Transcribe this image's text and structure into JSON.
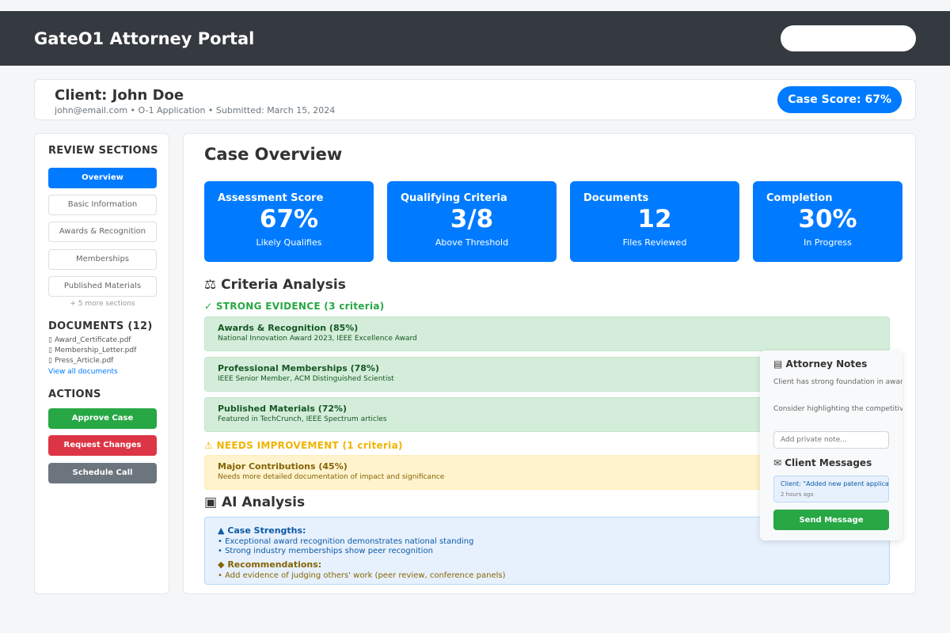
{
  "app": {
    "title": "GateO1 Attorney Portal",
    "search_placeholder": ""
  },
  "client": {
    "name": "Client: John Doe",
    "meta": "john@email.com • O-1 Application • Submitted: March 15, 2024",
    "case_score": "Case Score: 67%"
  },
  "sidebar": {
    "review_heading": "REVIEW SECTIONS",
    "sections": [
      {
        "label": "Overview",
        "active": true
      },
      {
        "label": "Basic Information",
        "active": false
      },
      {
        "label": "Awards & Recognition",
        "active": false
      },
      {
        "label": "Memberships",
        "active": false
      },
      {
        "label": "Published Materials",
        "active": false
      }
    ],
    "more_sections": "+ 5 more sections",
    "documents_heading": "DOCUMENTS (12)",
    "documents": [
      {
        "icon": "document-icon",
        "name": "Award_Certificate.pdf"
      },
      {
        "icon": "document-icon",
        "name": "Membership_Letter.pdf"
      },
      {
        "icon": "document-icon",
        "name": "Press_Article.pdf"
      }
    ],
    "view_all": "View all documents",
    "actions_heading": "ACTIONS",
    "actions": [
      {
        "label": "Approve Case",
        "color": "#28a745"
      },
      {
        "label": "Request Changes",
        "color": "#dc3545"
      },
      {
        "label": "Schedule Call",
        "color": "#6c757d"
      }
    ]
  },
  "main": {
    "title": "Case Overview",
    "stats": [
      {
        "label": "Assessment Score",
        "value": "67%",
        "sub": "Likely Qualifies"
      },
      {
        "label": "Qualifying Criteria",
        "value": "3/8",
        "sub": "Above Threshold"
      },
      {
        "label": "Documents",
        "value": "12",
        "sub": "Files Reviewed"
      },
      {
        "label": "Completion",
        "value": "30%",
        "sub": "In Progress"
      }
    ],
    "criteria_title": "Criteria Analysis",
    "strong_title": "✓ STRONG EVIDENCE (3 criteria)",
    "strong": [
      {
        "name": "Awards & Recognition (85%)",
        "desc": "National Innovation Award 2023, IEEE Excellence Award"
      },
      {
        "name": "Professional Memberships (78%)",
        "desc": "IEEE Senior Member, ACM Distinguished Scientist"
      },
      {
        "name": "Published Materials (72%)",
        "desc": "Featured in TechCrunch, IEEE Spectrum articles"
      }
    ],
    "needs_title": "NEEDS IMPROVEMENT (1 criteria)",
    "needs": [
      {
        "name": "Major Contributions (45%)",
        "desc": "Needs more detailed documentation of impact and significance"
      }
    ],
    "ai_title": "AI Analysis",
    "ai": {
      "strengths_title": "Case Strengths:",
      "strengths": [
        "• Exceptional award recognition demonstrates national standing",
        "• Strong industry memberships show peer recognition"
      ],
      "recommendations_title": "Recommendations:",
      "recommendations": [
        "• Add evidence of judging others' work (peer review, conference panels)"
      ]
    }
  },
  "notes_panel": {
    "title": "Attorney Notes",
    "notes": [
      "Client has strong foundation in awards and membership",
      "Consider highlighting the competitive nature of IEEE S"
    ],
    "input_placeholder": "Add private note...",
    "messages_title": "Client Messages",
    "message": "Client: \"Added new patent application documentation\"",
    "message_time": "2 hours ago",
    "send_label": "Send Message"
  },
  "colors": {
    "primary": "#007bff",
    "header": "#343a40",
    "success": "#28a745",
    "danger": "#dc3545",
    "secondary": "#6c757d",
    "strong_text": "#28a745",
    "needs_text": "#f0b400",
    "ai_strength_text": "#0c5aa6",
    "ai_reco_text": "#856404"
  }
}
